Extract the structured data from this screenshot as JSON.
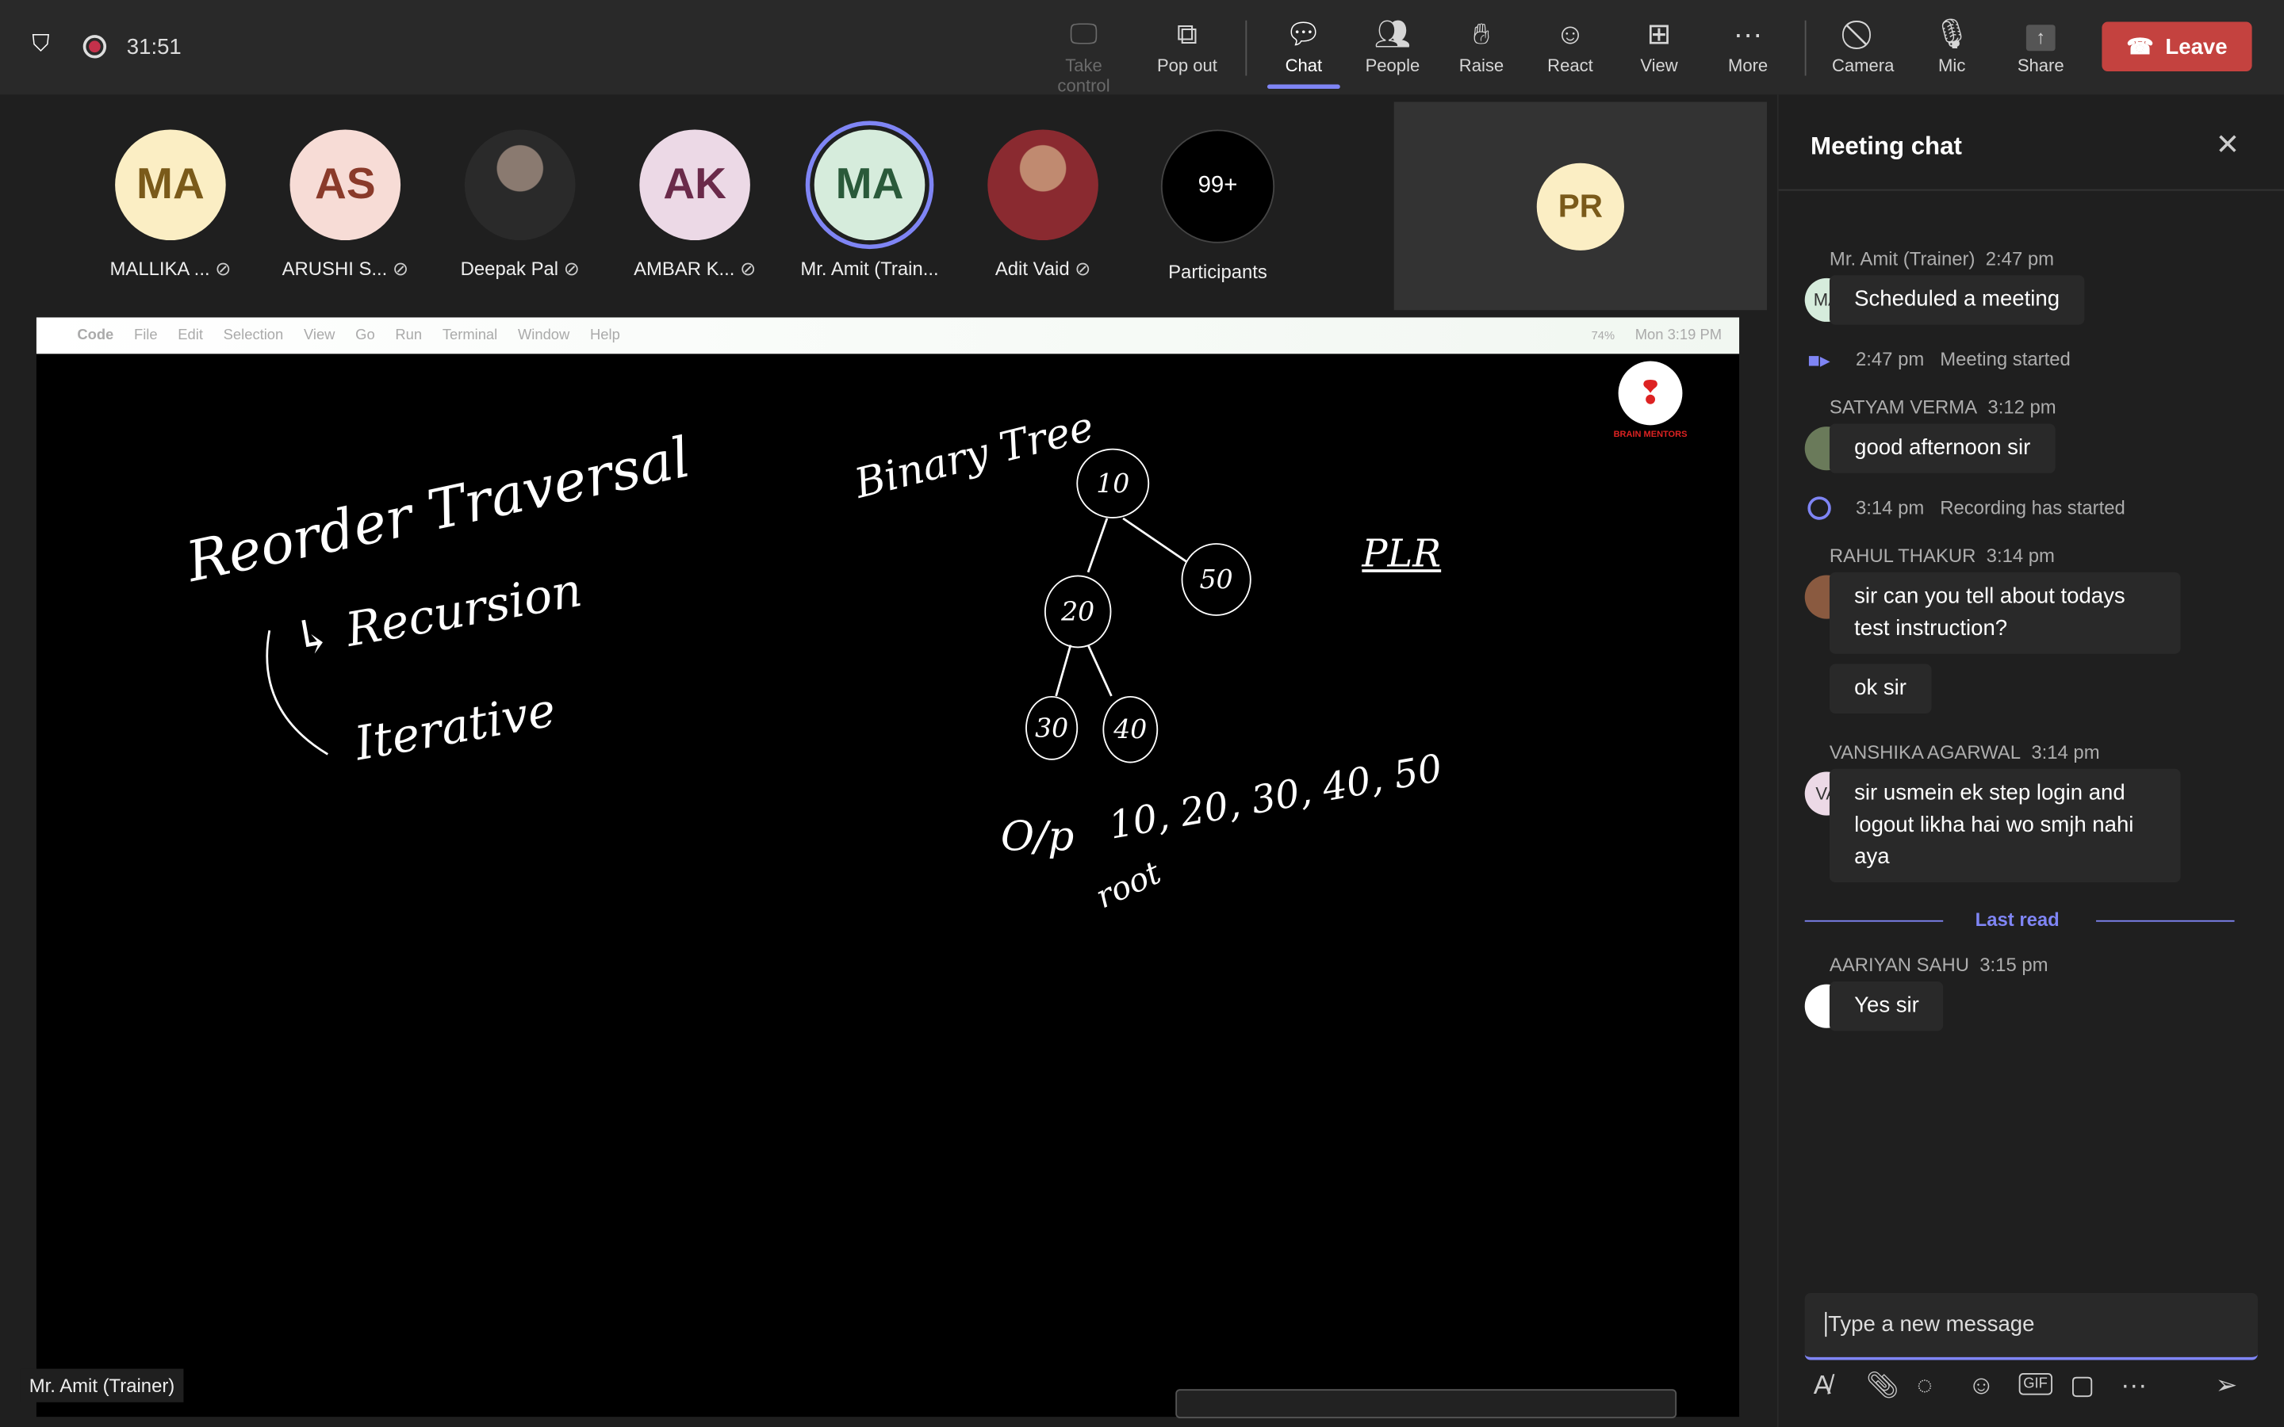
{
  "topbar": {
    "timer": "31:51",
    "buttons": [
      {
        "label": "Take control",
        "icon": "take-control-icon",
        "disabled": true
      },
      {
        "label": "Pop out",
        "icon": "pop-out-icon"
      },
      {
        "label": "Chat",
        "icon": "chat-icon",
        "active": true
      },
      {
        "label": "People",
        "icon": "people-icon"
      },
      {
        "label": "Raise",
        "icon": "hand-icon"
      },
      {
        "label": "React",
        "icon": "smile-icon"
      },
      {
        "label": "View",
        "icon": "grid-icon"
      },
      {
        "label": "More",
        "icon": "more-icon"
      },
      {
        "label": "Camera",
        "icon": "camera-off-icon"
      },
      {
        "label": "Mic",
        "icon": "mic-off-icon"
      },
      {
        "label": "Share",
        "icon": "share-icon"
      }
    ],
    "leave": "Leave",
    "colors": {
      "leave": "#c4423f",
      "accent": "#7f85f5"
    }
  },
  "participants": [
    {
      "initials": "MA",
      "name": "MALLIKA ...",
      "bg": "#fbeec4",
      "fg": "#7a5a1a"
    },
    {
      "initials": "AS",
      "name": "ARUSHI S...",
      "bg": "#f7dcd6",
      "fg": "#8a3a2a"
    },
    {
      "initials": "",
      "name": "Deepak Pal",
      "bg": "#555",
      "fg": "#fff"
    },
    {
      "initials": "AK",
      "name": "AMBAR K...",
      "bg": "#ecd9e6",
      "fg": "#6a2a4a"
    },
    {
      "initials": "MA",
      "name": "Mr. Amit (Train...",
      "bg": "#d6ecdc",
      "fg": "#2a5a3a"
    },
    {
      "initials": "",
      "name": "Adit Vaid",
      "bg": "#b07060",
      "fg": "#fff"
    }
  ],
  "participants_more": {
    "count": "99+",
    "label": "Participants"
  },
  "self_tile": {
    "initials": "PR"
  },
  "screen": {
    "menubar": [
      "Code",
      "File",
      "Edit",
      "Selection",
      "View",
      "Go",
      "Run",
      "Terminal",
      "Window",
      "Help"
    ],
    "battery": "74%",
    "clock": "Mon 3:19 PM",
    "logo_text": "BRAIN MENTORS",
    "board": {
      "title1": "Reorder Traversal",
      "sub1": "↳ Recursion",
      "sub2": "Iterative",
      "title2": "Binary Tree",
      "nodes": [
        "10",
        "50",
        "20",
        "30",
        "40"
      ],
      "order": "PLR",
      "op": "O/p",
      "output": "10, 20, 30, 40, 50",
      "root": "root"
    }
  },
  "presenter_label": "Mr. Amit (Trainer)",
  "chat": {
    "title": "Meeting chat",
    "messages": [
      {
        "type": "msg",
        "sender": "Mr. Amit (Trainer)",
        "time": "2:47 pm",
        "initials": "MA",
        "text": "Scheduled a meeting"
      },
      {
        "type": "sys",
        "time": "2:47 pm",
        "text": "Meeting started"
      },
      {
        "type": "msg",
        "sender": "SATYAM VERMA",
        "time": "3:12 pm",
        "initials": "",
        "text": "good afternoon sir"
      },
      {
        "type": "sys",
        "time": "3:14 pm",
        "text": "Recording has started"
      },
      {
        "type": "msg",
        "sender": "RAHUL THAKUR",
        "time": "3:14 pm",
        "initials": "",
        "text": "sir can you tell about todays test instruction?",
        "text2": "ok sir"
      },
      {
        "type": "msg",
        "sender": "VANSHIKA AGARWAL",
        "time": "3:14 pm",
        "initials": "VA",
        "text": "sir usmein ek step login and logout likha hai wo smjh nahi aya"
      },
      {
        "type": "divider",
        "text": "Last read"
      },
      {
        "type": "msg",
        "sender": "AARIYAN SAHU",
        "time": "3:15 pm",
        "initials": "",
        "text": "Yes sir"
      }
    ],
    "input_placeholder": "Type a new message"
  }
}
